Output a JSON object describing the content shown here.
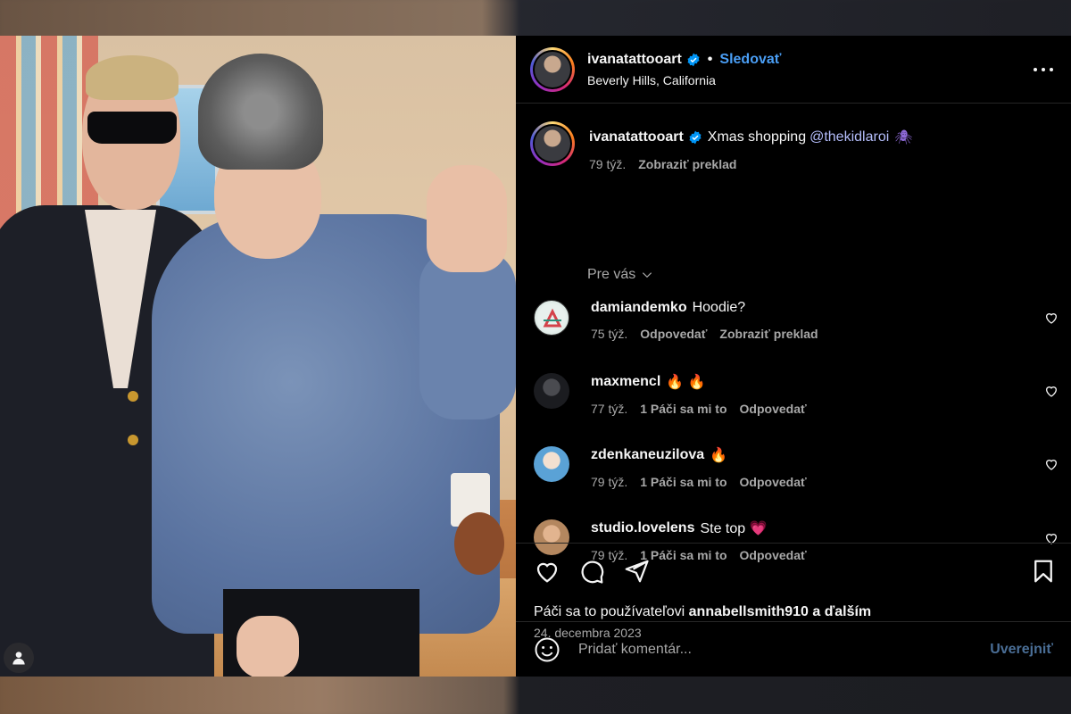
{
  "post": {
    "username": "ivanatattooart",
    "follow_label": "Sledovať",
    "location": "Beverly Hills, California",
    "more_icon": "more-horizontal-icon",
    "caption": {
      "username": "ivanatattooart",
      "text": "Xmas shopping",
      "mention": "@thekidlaroi",
      "emoji": "🕷",
      "time": "79 týž.",
      "translate": "Zobraziť preklad"
    }
  },
  "filter": {
    "label": "Pre vás"
  },
  "comments": [
    {
      "username": "damiandemko",
      "text": "Hoodie?",
      "time": "75 týž.",
      "reply": "Odpovedať",
      "translate": "Zobraziť preklad"
    },
    {
      "username": "maxmencl",
      "text": "🔥 🔥",
      "time": "77 týž.",
      "likes": "1 Páči sa mi to",
      "reply": "Odpovedať"
    },
    {
      "username": "zdenkaneuzilova",
      "text": "🔥",
      "time": "79 týž.",
      "likes": "1 Páči sa mi to",
      "reply": "Odpovedať"
    },
    {
      "username": "studio.lovelens",
      "text": "Ste top 💗",
      "time": "79 týž.",
      "likes": "1 Páči sa mi to",
      "reply": "Odpovedať"
    }
  ],
  "likes_line": {
    "prefix": "Páči sa to používateľovi",
    "user": "annabellsmith910",
    "suffix": "a ďalším"
  },
  "date": "24. decembra 2023",
  "add_comment": {
    "placeholder": "Pridať komentár...",
    "post_label": "Uverejniť"
  },
  "colors": {
    "accent": "#4a9ef5",
    "mention": "#b4bdfb",
    "muted": "#a8a8a8",
    "panel_bg": "#000000"
  }
}
